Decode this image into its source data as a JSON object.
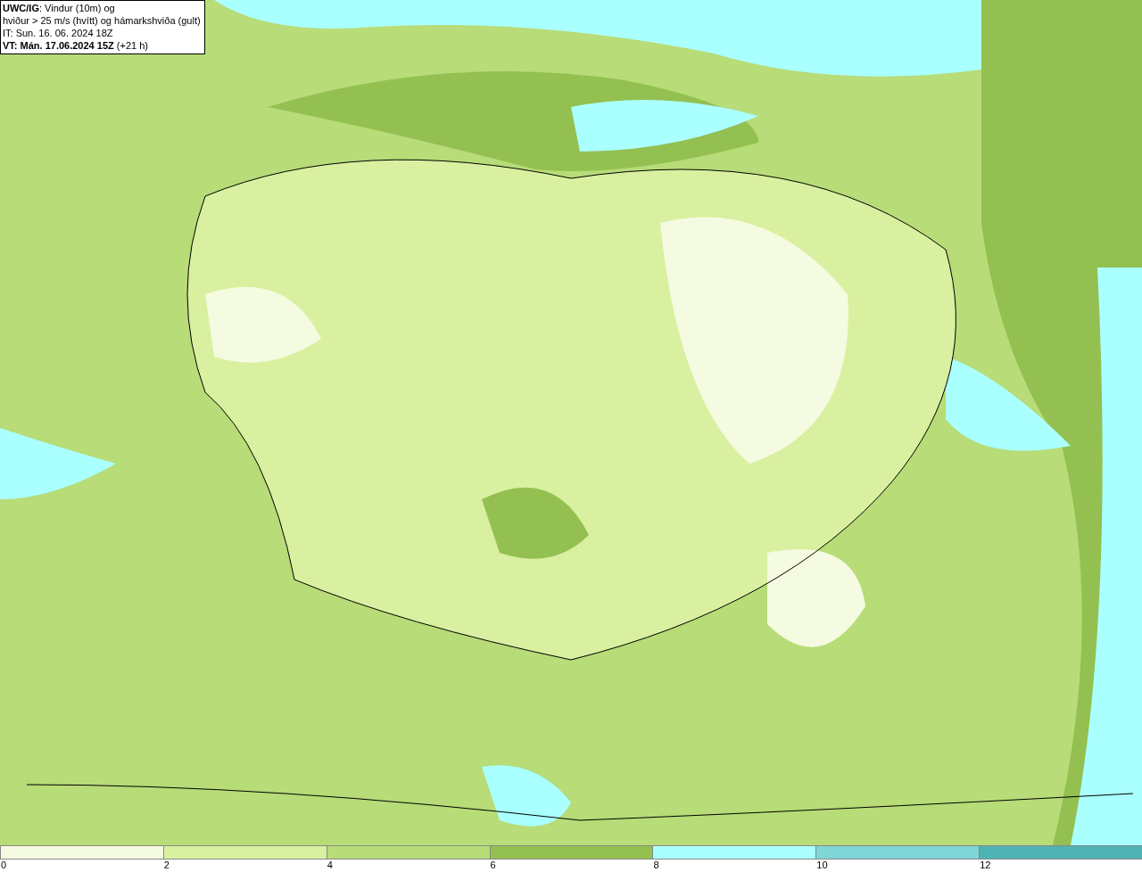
{
  "title_box": {
    "lines": [
      "**UWC/IG**: Vindur (10m) og",
      "hviður > 25 m/s (hvítt) og hámarkshviða (gult)",
      "IT: Sun. 16. 06. 2024 18Z",
      "**VT: Mán. 17.06.2024 15Z** (+21 h)"
    ]
  },
  "legend": {
    "bins": [
      {
        "color": "#f4fbe0"
      },
      {
        "color": "#d9f0a0"
      },
      {
        "color": "#b7dc78"
      },
      {
        "color": "#93c050"
      },
      {
        "color": "#aaffff"
      },
      {
        "color": "#7ed6d6"
      },
      {
        "color": "#4fb3b3"
      }
    ],
    "ticks": [
      "0",
      "2",
      "4",
      "6",
      "8",
      "10",
      "12"
    ]
  }
}
